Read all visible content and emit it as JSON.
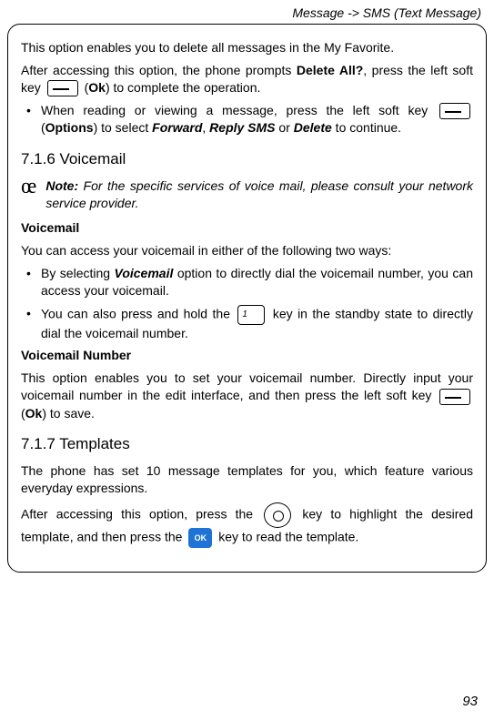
{
  "header": "Message -> SMS (Text Message)",
  "p1a": "This option enables you to delete all messages in the My Favorite.",
  "p2a": "After accessing this option, the phone prompts ",
  "p2b": "Delete All?",
  "p2c": ", press the left soft key ",
  "p2d": " (",
  "p2e": "Ok",
  "p2f": ") to complete the operation.",
  "b1a": "When reading or viewing a message, press the left soft key ",
  "b1b": " (",
  "b1c": "Options",
  "b1d": ") to select ",
  "b1e": "Forward",
  "b1f": ", ",
  "b1g": "Reply SMS",
  "b1h": " or ",
  "b1i": "Delete",
  "b1j": " to continue.",
  "h1": "7.1.6 Voicemail",
  "note_label": "Note:",
  "note_body": " For the specific services of voice mail, please consult your network service provider.",
  "vm_head": "Voicemail",
  "vm_p1": "You can access your voicemail in either of the following two ways:",
  "vb1a": "By selecting ",
  "vb1b": "Voicemail",
  "vb1c": " option to directly dial the voicemail number, you can access your voicemail.",
  "vb2a": "You can also press and hold the ",
  "vb2b": " key in the standby state to directly dial the voicemail number.",
  "vn_head": "Voicemail Number",
  "vn_p_a": "This option enables you to set your voicemail number. Directly input your voicemail number in the edit interface, and then press the left soft key ",
  "vn_p_b": " (",
  "vn_p_c": "Ok",
  "vn_p_d": ") to save.",
  "h2": "7.1.7 Templates",
  "t_p1": "The phone has set 10 message templates for you, which feature various everyday expressions.",
  "t_p2a": "After accessing this option, press the ",
  "t_p2b": " key to highlight the desired template, and then press the ",
  "t_p2c": " key to read the template.",
  "ok_btn": "OK",
  "page_num": "93"
}
